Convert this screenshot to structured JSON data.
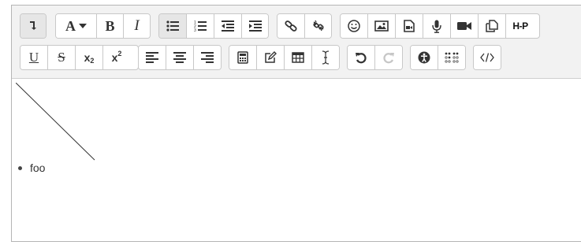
{
  "toolbar": {
    "row1": {
      "collapse_icon": "collapse-toolbar-icon",
      "font_style_label": "A",
      "bold_label": "B",
      "italic_label": "I",
      "h5p_label": "H-P"
    },
    "row2": {
      "underline_label": "U",
      "strikethrough_label": "S",
      "subscript_label": "x",
      "subscript_mark": "2",
      "superscript_label": "x",
      "superscript_mark": "2"
    }
  },
  "content": {
    "list_items": [
      "foo"
    ]
  },
  "colors": {
    "toolbar_bg": "#f2f2f2",
    "button_bg": "#ffffff",
    "active_bg": "#e6e6e6",
    "border": "#c8c8c8",
    "disabled": "#c6c6c6"
  }
}
